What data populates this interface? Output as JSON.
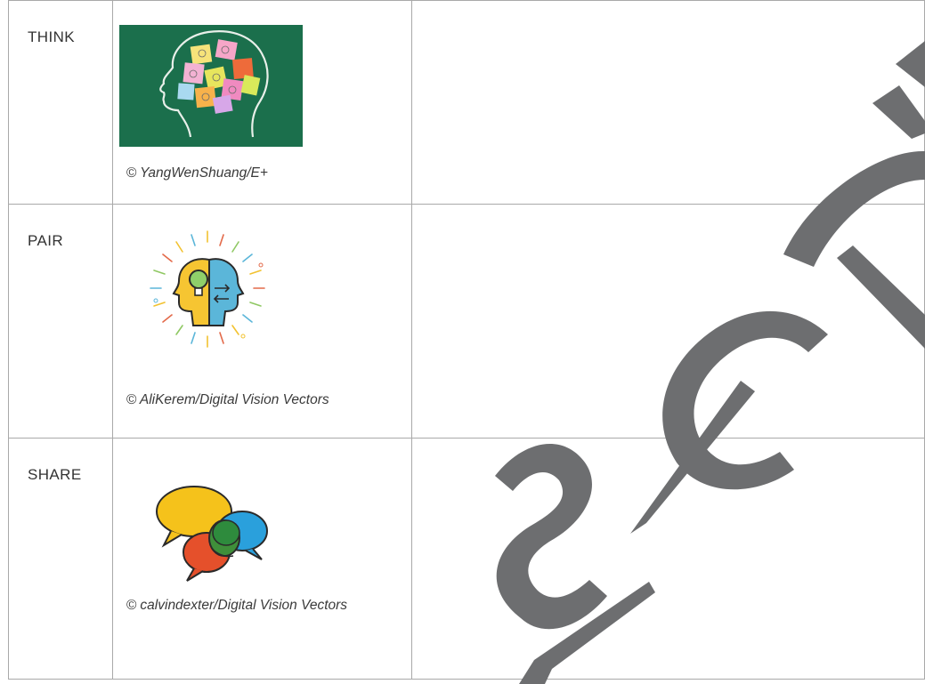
{
  "rows": [
    {
      "stage": "THINK",
      "credit": "© YangWenShuang/E+",
      "image": "think-head-sticky-notes-photo"
    },
    {
      "stage": "PAIR",
      "credit": "© AliKerem/Digital Vision Vectors",
      "image": "pair-two-heads-lightbulb-icon"
    },
    {
      "stage": "SHARE",
      "credit": "© calvindexter/Digital Vision Vectors",
      "image": "share-speech-bubbles-icon"
    }
  ],
  "watermark": {
    "color": "#6d6e70"
  }
}
